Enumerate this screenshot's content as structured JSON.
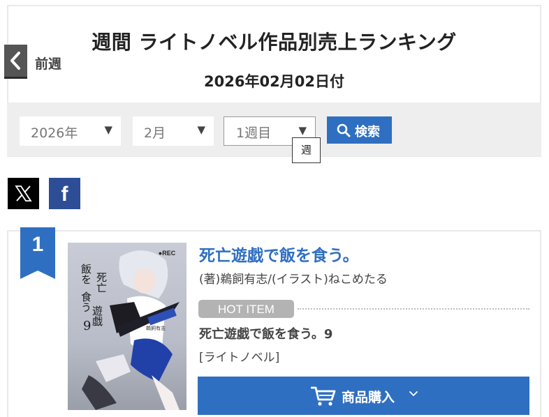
{
  "header": {
    "title": "週間 ライトノベル作品別売上ランキング",
    "date": "2026年02月02日付",
    "prev_label": "前週"
  },
  "search": {
    "year": "2026年",
    "month": "2月",
    "week": "1週目",
    "button_label": "検索",
    "tooltip": "週"
  },
  "share": {
    "x_icon": "x-logo-icon",
    "facebook_label": "f"
  },
  "ranking": [
    {
      "rank": "1",
      "title": "死亡遊戯で飯を食う。",
      "author": "(著)鵜飼有志/(イラスト)ねこめたる",
      "hot_label": "HOT ITEM",
      "hot_title": "死亡遊戯で飯を食う。9",
      "category": "[ライトノベル]",
      "buy_label": "商品購入",
      "cover_text": {
        "rec": "●REC",
        "title_lines": [
          "死亡",
          "遊戯",
          "で",
          "飯を",
          "食う"
        ],
        "volume": "9",
        "author_small": "鵜飼有志"
      }
    }
  ],
  "colors": {
    "accent": "#2f6fc1",
    "facebook": "#2d4e96",
    "hot_badge": "#b3b3b3",
    "panel_gray": "#eeeeee"
  }
}
